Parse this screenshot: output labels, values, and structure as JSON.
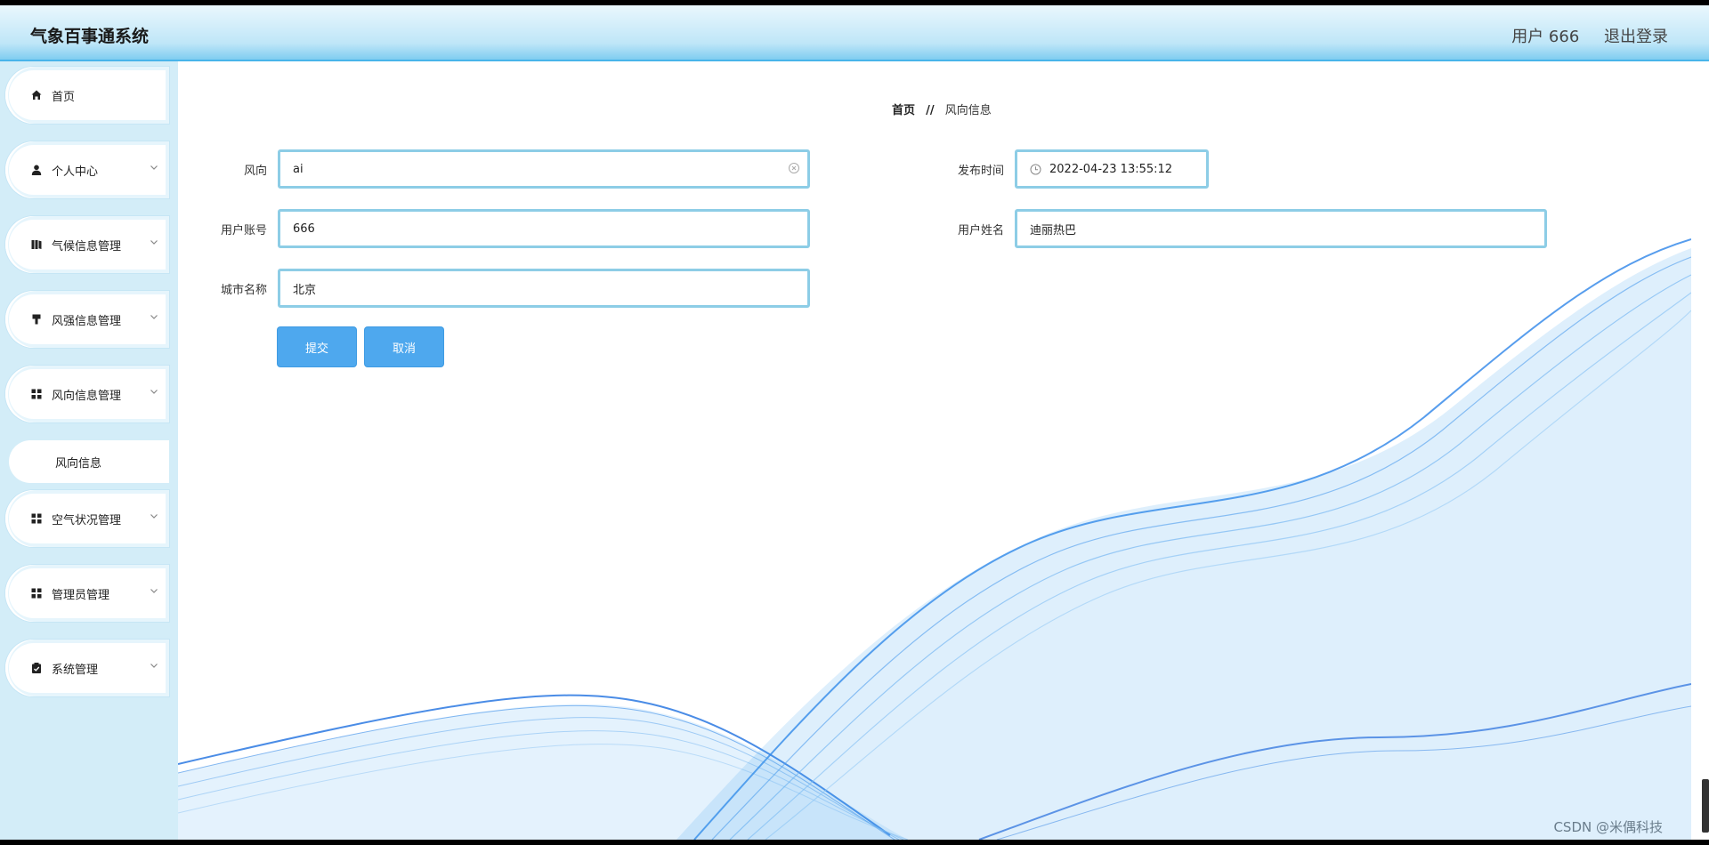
{
  "header": {
    "title": "气象百事通系统",
    "user_label": "用户 666",
    "logout_label": "退出登录"
  },
  "sidebar": {
    "items": [
      {
        "label": "首页",
        "icon": "home-icon"
      },
      {
        "label": "个人中心",
        "icon": "user-icon"
      },
      {
        "label": "气候信息管理",
        "icon": "book-icon"
      },
      {
        "label": "风强信息管理",
        "icon": "brush-icon"
      },
      {
        "label": "风向信息管理",
        "icon": "grid-icon"
      },
      {
        "label": "空气状况管理",
        "icon": "grid-icon"
      },
      {
        "label": "管理员管理",
        "icon": "grid-icon"
      },
      {
        "label": "系统管理",
        "icon": "clipboard-icon"
      }
    ],
    "sub_item": {
      "label": "风向信息"
    }
  },
  "breadcrumb": {
    "home": "首页",
    "separator": "//",
    "current": "风向信息"
  },
  "form": {
    "wind_direction": {
      "label": "风向",
      "value": "ai"
    },
    "publish_time": {
      "label": "发布时间",
      "value": "2022-04-23 13:55:12"
    },
    "user_account": {
      "label": "用户账号",
      "value": "666"
    },
    "user_name": {
      "label": "用户姓名",
      "value": "迪丽热巴"
    },
    "city_name": {
      "label": "城市名称",
      "value": "北京"
    },
    "submit_label": "提交",
    "cancel_label": "取消"
  },
  "watermark": "CSDN @米偶科技",
  "colors": {
    "accent": "#4ea8ee",
    "field_border": "#8dcde6",
    "sidebar_bg": "#d3edf8",
    "header_border": "#48b4ea"
  }
}
